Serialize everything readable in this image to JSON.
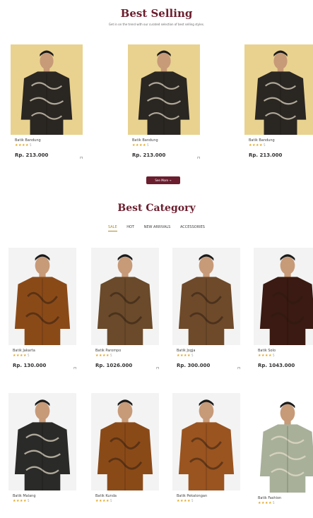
{
  "best_selling": {
    "title": "Best Selling",
    "subtitle": "Get in on the trend with our curated selection of best selling styles.",
    "see_more_label": "See More →",
    "products": [
      {
        "name": "Batik Bandung",
        "rating_count": "5",
        "price": "Rp. 213.000",
        "bg": "#e9d290"
      },
      {
        "name": "Batik Bandung",
        "rating_count": "5",
        "price": "Rp. 213.000",
        "bg": "#e9d290"
      },
      {
        "name": "Batik Bandung",
        "rating_count": "5",
        "price": "Rp. 213.000",
        "bg": "#e9d290"
      }
    ]
  },
  "best_category": {
    "title": "Best Category",
    "tabs": [
      "SALE",
      "HOT",
      "NEW ARRIVALS",
      "ACCESSORIES"
    ],
    "active_tab": "SALE",
    "products_row1": [
      {
        "name": "Batik Jakarta",
        "rating_count": "5",
        "price": "Rp. 130.000",
        "shirt": "#8a4a18"
      },
      {
        "name": "Batik Parompo",
        "rating_count": "5",
        "price": "Rp. 1026.000",
        "shirt": "#6a4a2a"
      },
      {
        "name": "Batik Jogja",
        "rating_count": "5",
        "price": "Rp. 300.000",
        "shirt": "#6e4a2a"
      },
      {
        "name": "Batik Solo",
        "rating_count": "5",
        "price": "Rp. 1043.000",
        "shirt": "#3a1a12"
      }
    ],
    "products_row2": [
      {
        "name": "Batik Malang",
        "rating_count": "5",
        "shirt": "#2a2a28"
      },
      {
        "name": "Batik Kunda",
        "rating_count": "5",
        "shirt": "#8a4a18"
      },
      {
        "name": "Batik Pekalongan",
        "rating_count": "5",
        "shirt": "#9a5420"
      },
      {
        "name": "Batik Fashion",
        "rating_count": "5",
        "shirt": "#a8b09a"
      }
    ]
  },
  "icons": {
    "star": "star-icon",
    "cart": "cart-icon"
  }
}
